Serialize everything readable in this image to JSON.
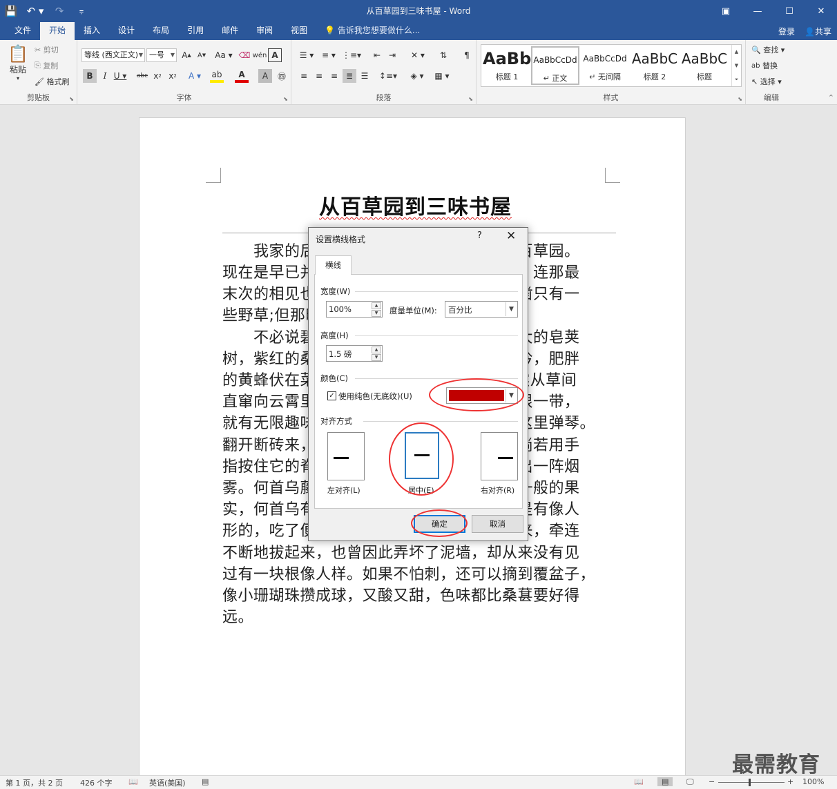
{
  "window": {
    "title": "从百草园到三味书屋 - Word"
  },
  "tabs": [
    "文件",
    "开始",
    "插入",
    "设计",
    "布局",
    "引用",
    "邮件",
    "审阅",
    "视图"
  ],
  "tellme": "告诉我您想要做什么...",
  "account": {
    "signin": "登录",
    "share": "共享"
  },
  "clipboard": {
    "paste": "粘贴",
    "cut": "剪切",
    "copy": "复制",
    "format_painter": "格式刷",
    "label": "剪贴板"
  },
  "font": {
    "name": "等线 (西文正文)",
    "size": "一号",
    "label": "字体"
  },
  "paragraph": {
    "label": "段落"
  },
  "styles": {
    "label": "样式",
    "items": [
      {
        "sample": "AaBb",
        "name": "标题 1"
      },
      {
        "sample": "AaBbCcDd",
        "name": "↵ 正文"
      },
      {
        "sample": "AaBbCcDd",
        "name": "↵ 无间隔"
      },
      {
        "sample": "AaBbC",
        "name": "标题 2"
      },
      {
        "sample": "AaBbC",
        "name": "标题"
      }
    ]
  },
  "editing": {
    "find": "查找",
    "replace": "替换",
    "select": "选择",
    "label": "编辑"
  },
  "document": {
    "title": "从百草园到三味书屋",
    "lines": [
      "　　我家的后面有一个很大的园，相传叫作百草园。",
      "现在是早已并屋子一起卖给朱文公的子孙了，连那最",
      "末次的相见也已经隔了七八年，其中似乎确凿只有一",
      "些野草;但那时却是我的乐园。",
      "　　不必说碧绿的菜畦，光滑的石井栏，高大的皂荚",
      "树，紫红的桑椹；也不必说鸣蝉在树叶里长吟，肥胖",
      "的黄蜂伏在菜花上，轻捷的叫天子(云雀)忽然从草间",
      "直窜向云霄里去了。单是周围的短短的泥墙根一带，",
      "就有无限趣味。油蛉在这里低唱，蟋蟀们在这里弹琴。",
      "翻开断砖来，有时会遇见蜈蚣；还有斑蝥，倘若用手",
      "指按住它的脊梁，便会拍的一声，从后窍喷出一阵烟",
      "雾。何首乌藤和木莲藤缠络着，木莲有莲房一般的果",
      "实，何首乌有臃肿的根。有人说，何首乌根是有像人",
      "形的，吃了便可以成仙，我于是常常拔它起来，牵连",
      "不断地拔起来，也曾因此弄坏了泥墙，却从来没有见",
      "过有一块根像人样。如果不怕刺，还可以摘到覆盆子，",
      "像小珊瑚珠攒成球，又酸又甜，色味都比桑葚要好得",
      "远。"
    ]
  },
  "dialog": {
    "title": "设置横线格式",
    "help": "?",
    "close": "✕",
    "tab": "横线",
    "width_label": "宽度(W)",
    "width_value": "100%",
    "unit_label": "度量单位(M):",
    "unit_value": "百分比",
    "height_label": "高度(H)",
    "height_value": "1.5 磅",
    "color_label": "颜色(C)",
    "solid_label": "使用纯色(无底纹)(U)",
    "color_value": "#c00000",
    "align_label": "对齐方式",
    "align_left": "左对齐(L)",
    "align_center": "居中(E)",
    "align_right": "右对齐(R)",
    "ok": "确定",
    "cancel": "取消"
  },
  "status": {
    "page": "第 1 页，共 2 页",
    "words": "426 个字",
    "language": "英语(美国)",
    "zoom": "100%"
  },
  "watermark": "最需教育",
  "colors": {
    "accent": "#2b579a",
    "highlight_ring": "#e33333",
    "line_color": "#c00000"
  }
}
